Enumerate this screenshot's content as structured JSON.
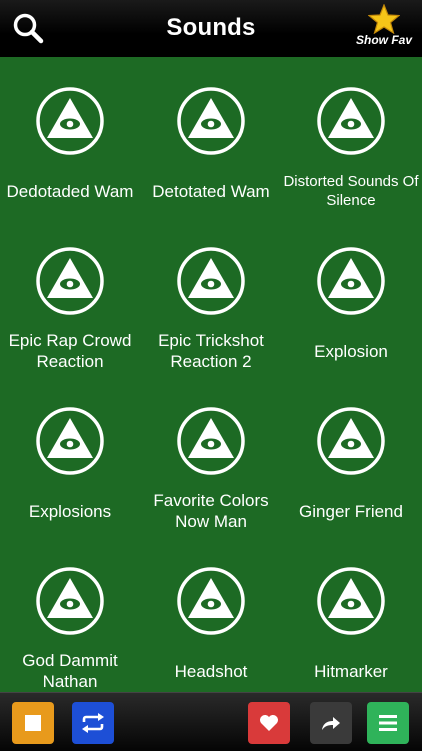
{
  "header": {
    "title": "Sounds",
    "show_fav_label": "Show Fav"
  },
  "sounds": [
    {
      "label": "Dedotaded Wam"
    },
    {
      "label": "Detotated Wam"
    },
    {
      "label": "Distorted Sounds Of Silence"
    },
    {
      "label": "Epic Rap Crowd Reaction"
    },
    {
      "label": "Epic Trickshot Reaction 2"
    },
    {
      "label": "Explosion"
    },
    {
      "label": "Explosions"
    },
    {
      "label": "Favorite Colors Now Man"
    },
    {
      "label": "Ginger Friend"
    },
    {
      "label": "God Dammit Nathan"
    },
    {
      "label": "Headshot"
    },
    {
      "label": "Hitmarker"
    }
  ],
  "toolbar": {
    "buttons": [
      "stop",
      "repeat",
      "favorite",
      "share",
      "menu"
    ]
  },
  "colors": {
    "background": "#1d6a24",
    "stop": "#e89a1c",
    "repeat": "#1d4fd6",
    "favorite": "#d93a3a",
    "share": "#3a3a3a",
    "menu": "#2fb35a"
  }
}
